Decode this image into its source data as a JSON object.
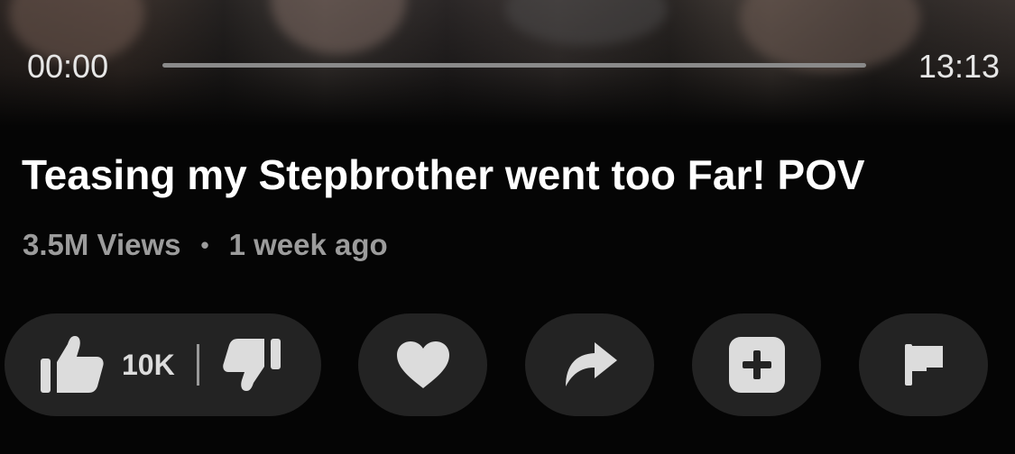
{
  "player": {
    "current_time": "00:00",
    "total_time": "13:13",
    "progress": 0
  },
  "video": {
    "title": "Teasing my Stepbrother went too Far! POV",
    "views": "3.5M Views",
    "separator": "•",
    "posted": "1 week ago"
  },
  "actions": {
    "like_count": "10K",
    "icons": [
      "thumbs-up-icon",
      "thumbs-down-icon",
      "heart-icon",
      "share-arrow-icon",
      "plus-square-icon",
      "flag-icon"
    ]
  },
  "colors": {
    "background": "#050505",
    "pill": "#232323",
    "icon": "#dcdcdc",
    "text_primary": "#ffffff",
    "text_secondary": "#9c9c9c"
  }
}
